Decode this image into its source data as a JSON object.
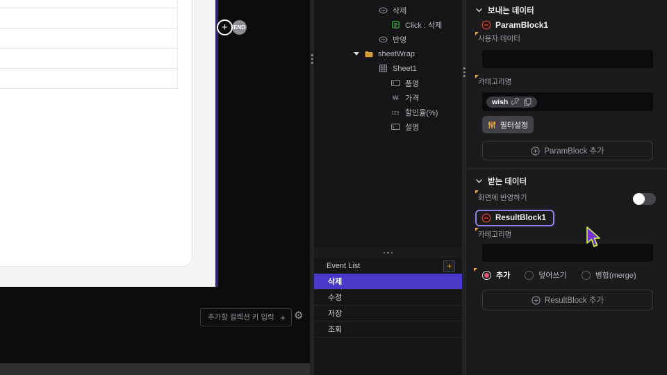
{
  "colors": {
    "selection_purple": "#4a38c8",
    "highlight_purple": "#8f7ff0",
    "accent_orange": "#e8a33d",
    "accent_red": "#bf4436",
    "accent_green": "#3fae4a",
    "radio_selected": "#e4506e",
    "canvas_line_purple": "#32276f"
  },
  "icons": {
    "gear_glyph": "⚙"
  },
  "canvas": {
    "plus_node": "+",
    "end_node": "END"
  },
  "collection_bar": {
    "placeholder": "추가할 컬렉션 키 입력",
    "add_icon": "+"
  },
  "tree": {
    "items": [
      {
        "id": "delete",
        "icon": "oval-minus",
        "label": "삭제",
        "depth": 2
      },
      {
        "id": "click-delete",
        "icon": "event-script",
        "label": "Click : 삭제",
        "depth": 3
      },
      {
        "id": "apply",
        "icon": "oval-minus",
        "label": "반영",
        "depth": 2
      },
      {
        "id": "sheetwrap",
        "icon": "folder",
        "label": "sheetWrap",
        "depth": 1,
        "expanded": true
      },
      {
        "id": "sheet1",
        "icon": "sheet-grid",
        "label": "Sheet1",
        "depth": 2
      },
      {
        "id": "field-name",
        "icon": "text-field",
        "label": "품명",
        "depth": 3
      },
      {
        "id": "field-price",
        "icon": "currency",
        "label": "가격",
        "depth": 3
      },
      {
        "id": "field-discount",
        "icon": "number",
        "label": "할인율(%)",
        "depth": 3
      },
      {
        "id": "field-desc",
        "icon": "text-field",
        "label": "설명",
        "depth": 3
      }
    ]
  },
  "event_list": {
    "title": "Event List",
    "add_icon": "+",
    "items": [
      {
        "id": "delete",
        "label": "삭제",
        "selected": true
      },
      {
        "id": "edit",
        "label": "수정",
        "selected": false
      },
      {
        "id": "save",
        "label": "저장",
        "selected": false
      },
      {
        "id": "query",
        "label": "조회",
        "selected": false
      }
    ]
  },
  "send_section": {
    "title": "보내는 데이터",
    "block_name": "ParamBlock1",
    "user_data_label": "사용자 데이터",
    "user_data_value": "",
    "category_label": "카테고리명",
    "category_chip": "wish",
    "filter_button": "필터설정",
    "add_button": "ParamBlock 추가"
  },
  "receive_section": {
    "title": "받는 데이터",
    "apply_label": "화면에 반영하기",
    "apply_toggle_on": false,
    "block_name": "ResultBlock1",
    "category_label": "카테고리명",
    "category_value": "",
    "radios": [
      {
        "id": "add",
        "label": "추가",
        "selected": true
      },
      {
        "id": "overwrite",
        "label": "덮어쓰기",
        "selected": false
      },
      {
        "id": "merge",
        "label": "병합(merge)",
        "selected": false
      }
    ],
    "add_button": "ResultBlock 추가"
  }
}
